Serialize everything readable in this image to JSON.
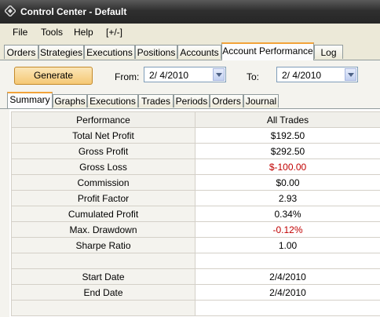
{
  "window": {
    "title": "Control Center - Default",
    "icon": "diamond-app-icon"
  },
  "menu": [
    "File",
    "Tools",
    "Help",
    "[+/-]"
  ],
  "main_tabs": [
    {
      "label": "Orders"
    },
    {
      "label": "Strategies"
    },
    {
      "label": "Executions"
    },
    {
      "label": "Positions"
    },
    {
      "label": "Accounts"
    },
    {
      "label": "Account Performance",
      "active": true
    },
    {
      "label": "Log"
    }
  ],
  "toolbar": {
    "generate_label": "Generate",
    "from_label": "From:",
    "from_value": "2/  4/2010",
    "to_label": "To:",
    "to_value": "2/  4/2010"
  },
  "sub_tabs": [
    {
      "label": "Summary",
      "active": true
    },
    {
      "label": "Graphs"
    },
    {
      "label": "Executions"
    },
    {
      "label": "Trades"
    },
    {
      "label": "Periods"
    },
    {
      "label": "Orders"
    },
    {
      "label": "Journal"
    }
  ],
  "grid": {
    "headers": [
      "Performance",
      "All Trades"
    ],
    "rows": [
      {
        "label": "Total Net Profit",
        "value": "$192.50"
      },
      {
        "label": "Gross Profit",
        "value": "$292.50"
      },
      {
        "label": "Gross Loss",
        "value": "$-100.00",
        "negative": true
      },
      {
        "label": "Commission",
        "value": "$0.00"
      },
      {
        "label": "Profit Factor",
        "value": "2.93"
      },
      {
        "label": "Cumulated Profit",
        "value": "0.34%"
      },
      {
        "label": "Max. Drawdown",
        "value": "-0.12%",
        "negative": true
      },
      {
        "label": "Sharpe Ratio",
        "value": "1.00"
      },
      {
        "label": "",
        "value": ""
      },
      {
        "label": "Start Date",
        "value": "2/4/2010"
      },
      {
        "label": "End Date",
        "value": "2/4/2010"
      },
      {
        "label": "",
        "value": ""
      }
    ]
  },
  "colors": {
    "negative": "#c00000",
    "active_tab_accent": "#f2a33a",
    "title_bar": "#2f2f2f"
  }
}
